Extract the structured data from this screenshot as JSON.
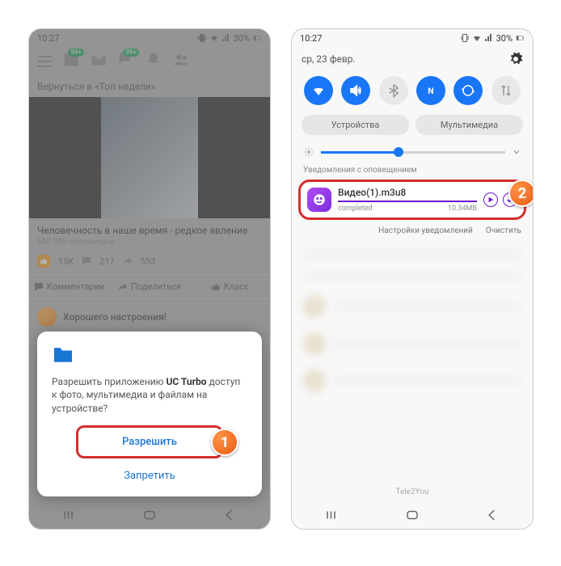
{
  "status": {
    "time": "10:27",
    "battery": "30%"
  },
  "left": {
    "back_link": "Вернуться в «Топ недели»",
    "post_title": "Человечность в наше время - редкое явление",
    "views": "588 085 просмотров",
    "likes": "15K",
    "comments_count": "217",
    "shares_count": "553",
    "action_comments": "Комментарии",
    "action_share": "Поделиться",
    "action_class": "Класс",
    "mood": "Хорошего настроения!",
    "dialog": {
      "msg_prefix": "Разрешить приложению ",
      "app": "UC Turbo",
      "msg_suffix": " доступ к фото, мультимедиа и файлам на устройстве?",
      "allow": "Разрешить",
      "deny": "Запретить"
    }
  },
  "right": {
    "date": "ср, 23 февр.",
    "chip_devices": "Устройства",
    "chip_media": "Мультимедиа",
    "section": "Уведомления с оповещением",
    "notif": {
      "title": "Видео(1).m3u8",
      "status": "completed",
      "size": "10.34MB"
    },
    "footer_settings": "Настройки уведомлений",
    "footer_clear": "Очистить",
    "carrier": "Tele2You"
  },
  "callouts": {
    "one": "1",
    "two": "2"
  }
}
